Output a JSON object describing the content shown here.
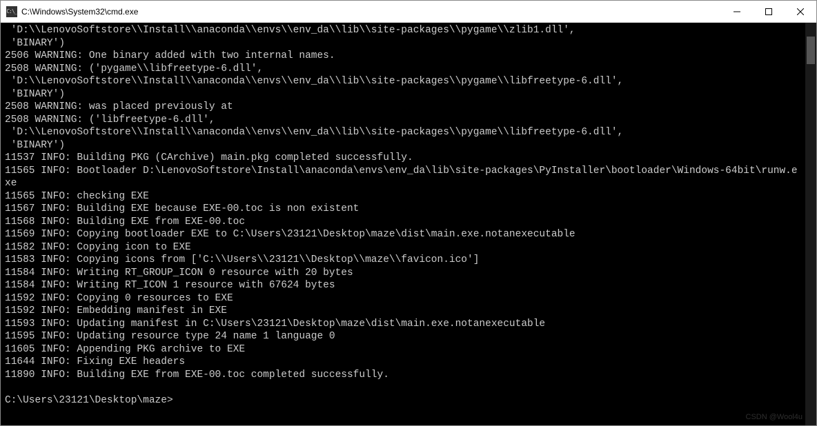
{
  "window": {
    "title": "C:\\Windows\\System32\\cmd.exe",
    "icon_text": "C:\\_"
  },
  "terminal": {
    "lines": [
      " 'D:\\\\LenovoSoftstore\\\\Install\\\\anaconda\\\\envs\\\\env_da\\\\lib\\\\site-packages\\\\pygame\\\\zlib1.dll',",
      " 'BINARY')",
      "2506 WARNING: One binary added with two internal names.",
      "2508 WARNING: ('pygame\\\\libfreetype-6.dll',",
      " 'D:\\\\LenovoSoftstore\\\\Install\\\\anaconda\\\\envs\\\\env_da\\\\lib\\\\site-packages\\\\pygame\\\\libfreetype-6.dll',",
      " 'BINARY')",
      "2508 WARNING: was placed previously at",
      "2508 WARNING: ('libfreetype-6.dll',",
      " 'D:\\\\LenovoSoftstore\\\\Install\\\\anaconda\\\\envs\\\\env_da\\\\lib\\\\site-packages\\\\pygame\\\\libfreetype-6.dll',",
      " 'BINARY')",
      "11537 INFO: Building PKG (CArchive) main.pkg completed successfully.",
      "11565 INFO: Bootloader D:\\LenovoSoftstore\\Install\\anaconda\\envs\\env_da\\lib\\site-packages\\PyInstaller\\bootloader\\Windows-64bit\\runw.exe",
      "11565 INFO: checking EXE",
      "11567 INFO: Building EXE because EXE-00.toc is non existent",
      "11568 INFO: Building EXE from EXE-00.toc",
      "11569 INFO: Copying bootloader EXE to C:\\Users\\23121\\Desktop\\maze\\dist\\main.exe.notanexecutable",
      "11582 INFO: Copying icon to EXE",
      "11583 INFO: Copying icons from ['C:\\\\Users\\\\23121\\\\Desktop\\\\maze\\\\favicon.ico']",
      "11584 INFO: Writing RT_GROUP_ICON 0 resource with 20 bytes",
      "11584 INFO: Writing RT_ICON 1 resource with 67624 bytes",
      "11592 INFO: Copying 0 resources to EXE",
      "11592 INFO: Embedding manifest in EXE",
      "11593 INFO: Updating manifest in C:\\Users\\23121\\Desktop\\maze\\dist\\main.exe.notanexecutable",
      "11595 INFO: Updating resource type 24 name 1 language 0",
      "11605 INFO: Appending PKG archive to EXE",
      "11644 INFO: Fixing EXE headers",
      "11890 INFO: Building EXE from EXE-00.toc completed successfully.",
      ""
    ],
    "prompt": "C:\\Users\\23121\\Desktop\\maze>"
  },
  "watermark": "CSDN @Wool4u"
}
